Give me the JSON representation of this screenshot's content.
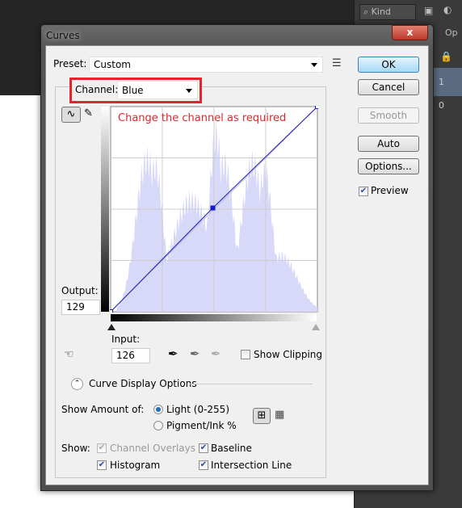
{
  "dialog": {
    "title": "Curves",
    "close_label": "x"
  },
  "right_panel": {
    "filter_label": "Kind",
    "opacity_label": "Op",
    "row1": "1",
    "row2": "0"
  },
  "preset": {
    "label": "Preset:",
    "value": "Custom"
  },
  "channel": {
    "label": "Channel:",
    "value": "Blue"
  },
  "annotation": {
    "text": "Change the channel as required",
    "color": "#e0262b"
  },
  "buttons": {
    "ok": "OK",
    "cancel": "Cancel",
    "smooth": "Smooth",
    "auto": "Auto",
    "options": "Options..."
  },
  "preview": {
    "label": "Preview",
    "checked": true
  },
  "output": {
    "label": "Output:",
    "value": "129"
  },
  "input": {
    "label": "Input:",
    "value": "126"
  },
  "show_clipping": {
    "label": "Show Clipping",
    "checked": false
  },
  "curve_display_options": {
    "label": "Curve Display Options"
  },
  "show_amount": {
    "label": "Show Amount of:",
    "options": [
      {
        "label": "Light  (0-255)",
        "selected": true
      },
      {
        "label": "Pigment/Ink %",
        "selected": false
      }
    ]
  },
  "show": {
    "label": "Show:",
    "options": [
      {
        "label": "Channel Overlays",
        "checked": true,
        "disabled": true
      },
      {
        "label": "Baseline",
        "checked": true
      },
      {
        "label": "Histogram",
        "checked": true
      },
      {
        "label": "Intersection Line",
        "checked": true
      }
    ]
  },
  "curve": {
    "points": [
      [
        0,
        0
      ],
      [
        126,
        129
      ],
      [
        255,
        255
      ]
    ],
    "line_color": "#1a1acc",
    "histogram_color": "#d8d8f8"
  }
}
